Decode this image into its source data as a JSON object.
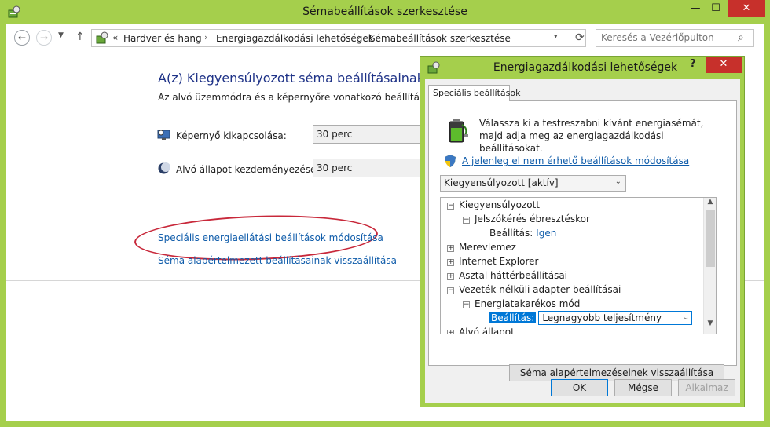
{
  "window": {
    "title": "Sémabeállítások szerkesztése",
    "minimize_label": "—",
    "maximize_label": "☐",
    "close_label": "✕"
  },
  "navigation": {
    "back_label": "←",
    "forward_label": "→",
    "dropdown_label": "▼",
    "up_label": "↑"
  },
  "address_bar": {
    "chevron": "«",
    "breadcrumbs": [
      "Hardver és hang",
      "Energiagazdálkodási lehetőségek",
      "Sémabeállítások szerkesztése"
    ],
    "separator": "›",
    "dropdown_label": "▾",
    "refresh_label": "⟳"
  },
  "search": {
    "placeholder": "Keresés a Vezérlőpulton",
    "icon_label": "⌕"
  },
  "main": {
    "heading": "A(z) Kiegyensúlyozott séma beállításainak módo",
    "description": "Az alvó üzemmódra és a képernyőre vonatkozó beállítások meg",
    "settings": [
      {
        "label": "Képernyő kikapcsolása:",
        "value": "30 perc",
        "icon": "monitor-icon"
      },
      {
        "label": "Alvó állapot kezdeményezése:",
        "value": "30 perc",
        "icon": "moon-icon"
      }
    ],
    "links": {
      "advanced": "Speciális energiaellátási beállítások módosítása",
      "restore": "Séma alapértelmezett beállításainak visszaállítása"
    }
  },
  "dialog": {
    "title": "Energiagazdálkodási lehetőségek",
    "help_label": "?",
    "close_label": "✕",
    "tab": "Speciális beállítások",
    "description": "Válassza ki a testreszabni kívánt energiasémát, majd adja meg az energiagazdálkodási beállításokat.",
    "unavailable_link": "A jelenleg el nem érhető beállítások módosítása",
    "plan_select": "Kiegyensúlyozott [aktív]",
    "chevron": "⌄",
    "tree": [
      {
        "toggle": "−",
        "text": "Kiegyensúlyozott",
        "level": 0
      },
      {
        "toggle": "−",
        "text": "Jelszókérés ébresztéskor",
        "level": 1
      },
      {
        "label": "Beállítás:",
        "value": "Igen",
        "level": 2
      },
      {
        "toggle": "+",
        "text": "Merevlemez",
        "level": 0
      },
      {
        "toggle": "+",
        "text": "Internet Explorer",
        "level": 0
      },
      {
        "toggle": "+",
        "text": "Asztal háttérbeállításai",
        "level": 0
      },
      {
        "toggle": "−",
        "text": "Vezeték nélküli adapter beállításai",
        "level": 0
      },
      {
        "toggle": "−",
        "text": "Energiatakarékos mód",
        "level": 1
      },
      {
        "label": "Beállítás:",
        "value": "Legnagyobb teljesítmény",
        "level": 2,
        "selected": true
      },
      {
        "toggle": "+",
        "text": "Alvó állapot",
        "level": 0
      }
    ],
    "scroll_up": "▲",
    "scroll_down": "▼",
    "restore_button": "Séma alapértelmezéseinek visszaállítása",
    "buttons": {
      "ok": "OK",
      "cancel": "Mégse",
      "apply": "Alkalmaz"
    }
  },
  "colors": {
    "accent": "#a5cf4c",
    "link": "#0f5caa",
    "close": "#c7302b",
    "highlight": "#0078d7"
  }
}
